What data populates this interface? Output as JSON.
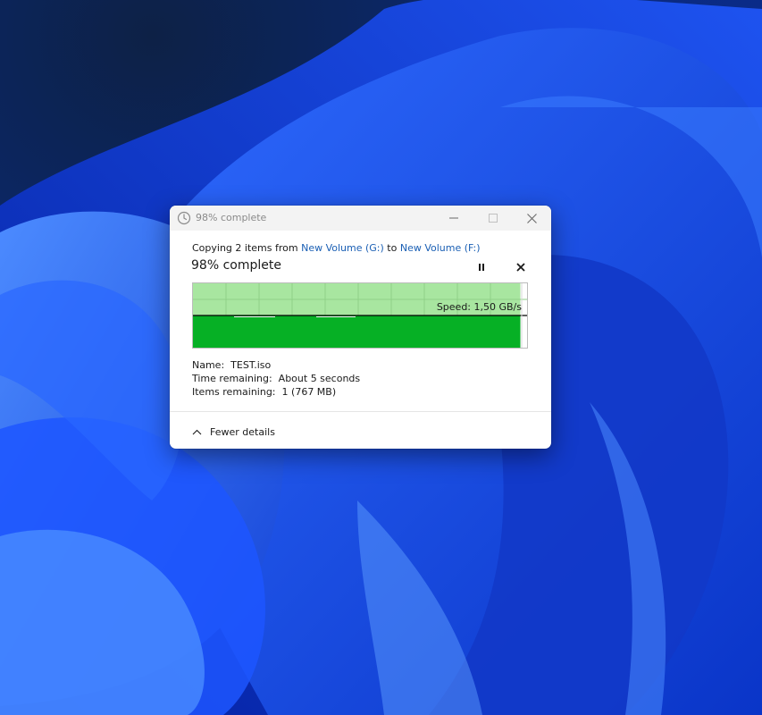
{
  "window": {
    "title": "98% complete"
  },
  "copy": {
    "prefix": "Copying 2 items from ",
    "source": "New Volume (G:)",
    "middle": " to ",
    "destination": "New Volume (F:)",
    "status": "98% complete",
    "progress_percent": 98
  },
  "graph": {
    "speed_label": "Speed: 1,50 GB/s"
  },
  "details": {
    "name_label": "Name:",
    "name_value": "TEST.iso",
    "time_label": "Time remaining:",
    "time_value": "About 5 seconds",
    "items_label": "Items remaining:",
    "items_value": "1 (767 MB)"
  },
  "footer": {
    "toggle_label": "Fewer details"
  },
  "colors": {
    "progress_dark": "#06b025",
    "progress_light": "#a8e6a0",
    "link": "#1a5fb4"
  }
}
